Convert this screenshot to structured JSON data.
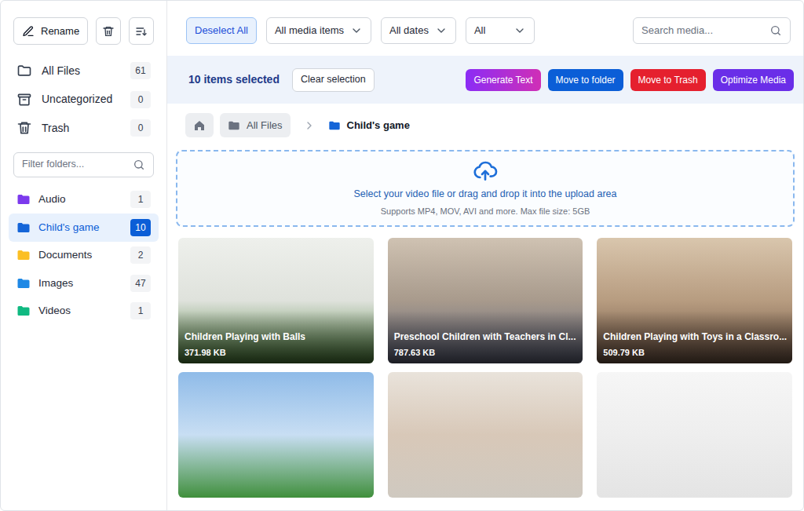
{
  "sidebar": {
    "toolbar": {
      "rename": "Rename"
    },
    "nav": [
      {
        "label": "All Files",
        "count": "61",
        "selected": false,
        "kind": "files"
      },
      {
        "label": "Uncategorized",
        "count": "0",
        "selected": false,
        "kind": "archive"
      },
      {
        "label": "Trash",
        "count": "0",
        "selected": false,
        "kind": "trash"
      }
    ],
    "filter": {
      "placeholder": "Filter folders..."
    },
    "folders": [
      {
        "label": "Audio",
        "count": "1",
        "color": "#7c3aed",
        "selected": false
      },
      {
        "label": "Child's game",
        "count": "10",
        "color": "#1565d8",
        "selected": true
      },
      {
        "label": "Documents",
        "count": "2",
        "color": "#fbbf24",
        "selected": false
      },
      {
        "label": "Images",
        "count": "47",
        "color": "#1e88e5",
        "selected": false
      },
      {
        "label": "Videos",
        "count": "1",
        "color": "#10b981",
        "selected": false
      }
    ]
  },
  "toolbar": {
    "deselect": "Deselect All",
    "filters": [
      {
        "label": "All media items"
      },
      {
        "label": "All dates"
      },
      {
        "label": "All"
      }
    ],
    "search": {
      "placeholder": "Search media..."
    }
  },
  "selection_bar": {
    "summary": "10 items selected",
    "clear": "Clear selection",
    "actions": [
      {
        "label": "Generate Text",
        "color": "#8b2cf5",
        "kind": "gradient"
      },
      {
        "label": "Move to folder",
        "color": "#0b5ed7",
        "kind": "solid"
      },
      {
        "label": "Move to Trash",
        "color": "#e5202e",
        "kind": "solid"
      },
      {
        "label": "Optimize Media",
        "color": "#6a2ee8",
        "kind": "solid"
      }
    ]
  },
  "breadcrumb": {
    "items": [
      {
        "label": "All Files"
      }
    ],
    "current": "Child's game"
  },
  "upload": {
    "title": "Select your video file or drag and drop it into the upload area",
    "hint": "Supports MP4, MOV, AVI and more. Max file size: 5GB"
  },
  "media": [
    {
      "kind": "captioned",
      "title": "Children Playing with Balls",
      "size": "371.98 KB"
    },
    {
      "kind": "captioned",
      "title": "Preschool Children with Teachers in Cl...",
      "size": "787.63 KB"
    },
    {
      "kind": "captioned",
      "title": "Children Playing with Toys in a Classro...",
      "size": "509.79 KB"
    },
    {
      "kind": "plain"
    },
    {
      "kind": "plain"
    },
    {
      "kind": "plain"
    }
  ]
}
